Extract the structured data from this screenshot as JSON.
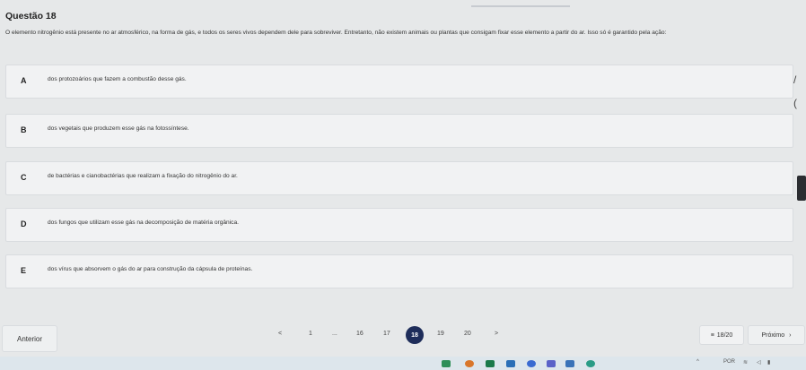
{
  "header": {
    "title": "Questão 18"
  },
  "question": {
    "text": "O elemento nitrogênio está presente no ar atmosférico, na forma de gás, e todos os seres vivos dependem dele para sobreviver. Entretanto, não existem animais ou plantas que consigam fixar esse elemento a partir do ar. Isso só é garantido pela ação:"
  },
  "options": [
    {
      "letter": "A",
      "text": "dos protozoários que fazem a combustão desse gás."
    },
    {
      "letter": "B",
      "text": "dos vegetais que produzem esse gás na fotossíntese."
    },
    {
      "letter": "C",
      "text": "de bactérias e cianobactérias que realizam a fixação do nitrogênio do ar."
    },
    {
      "letter": "D",
      "text": "dos fungos que utilizam esse gás na decomposição de matéria orgânica."
    },
    {
      "letter": "E",
      "text": "dos vírus que absorvem o gás do ar para construção da cápsula de proteínas."
    }
  ],
  "right_edge": {
    "glyph1": "/",
    "glyph2": "("
  },
  "nav": {
    "prev_label": "Anterior",
    "next_label": "Próximo",
    "prev_arrow": "<",
    "next_arrow": ">",
    "next_chevron": "›",
    "pages": [
      "1",
      "...",
      "16",
      "17",
      "18",
      "19",
      "20"
    ],
    "active_page": "18",
    "counter_text": "18/20",
    "counter_icon": "≡"
  },
  "taskbar": {
    "lang": "POR",
    "icons": [
      "chevron-up-icon",
      "wifi-icon",
      "volume-icon",
      "battery-icon"
    ]
  },
  "colors": {
    "active_page_bg": "#1e2d5a",
    "background": "#e6e8e9",
    "card_bg": "#f1f2f3"
  }
}
